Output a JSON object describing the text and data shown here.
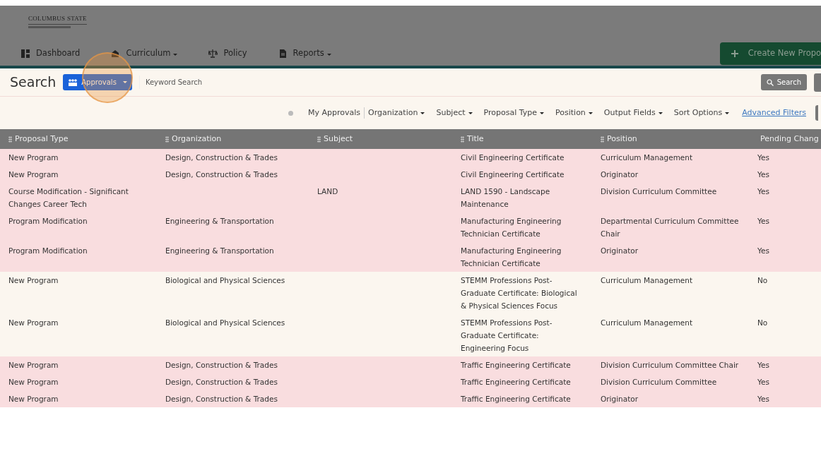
{
  "logo": {
    "text": "COLUMBUS STATE"
  },
  "nav": [
    {
      "label": "Dashboard",
      "kind": "link"
    },
    {
      "label": "Curriculum",
      "kind": "dropdown"
    },
    {
      "label": "Policy",
      "kind": "link"
    },
    {
      "label": "Reports",
      "kind": "dropdown"
    }
  ],
  "create_button": {
    "label": "Create New Propo"
  },
  "search_bar": {
    "title": "Search",
    "mode_button": "Approvals",
    "keyword": {
      "placeholder": "Keyword Search"
    },
    "search_button": "Search"
  },
  "filters": [
    {
      "kind": "plain",
      "label": "My Approvals"
    },
    {
      "kind": "dropdown",
      "label": "Organization"
    },
    {
      "kind": "dropdown",
      "label": "Subject"
    },
    {
      "kind": "dropdown",
      "label": "Proposal Type"
    },
    {
      "kind": "dropdown",
      "label": "Position"
    },
    {
      "kind": "dropdown",
      "label": "Output Fields"
    },
    {
      "kind": "dropdown",
      "label": "Sort Options"
    },
    {
      "kind": "link",
      "label": "Advanced Filters"
    }
  ],
  "table": {
    "columns": [
      "Proposal Type",
      "Organization",
      "Subject",
      "Title",
      "Position",
      "Pending Chang"
    ],
    "rows": [
      {
        "highlighted": true,
        "cells": [
          "New Program",
          "Design, Construction & Trades",
          "",
          "Civil Engineering Certificate",
          "Curriculum Management",
          "Yes"
        ]
      },
      {
        "highlighted": true,
        "cells": [
          "New Program",
          "Design, Construction & Trades",
          "",
          "Civil Engineering Certificate",
          "Originator",
          "Yes"
        ]
      },
      {
        "highlighted": true,
        "cells": [
          "Course Modification - Significant Changes Career Tech",
          "",
          "LAND",
          "LAND 1590 - Landscape Maintenance",
          "Division Curriculum Committee",
          "Yes"
        ]
      },
      {
        "highlighted": true,
        "cells": [
          "Program Modification",
          "Engineering & Transportation",
          "",
          "Manufacturing Engineering Technician Certificate",
          "Departmental Curriculum Committee Chair",
          "Yes"
        ]
      },
      {
        "highlighted": true,
        "cells": [
          "Program Modification",
          "Engineering & Transportation",
          "",
          "Manufacturing Engineering Technician Certificate",
          "Originator",
          "Yes"
        ]
      },
      {
        "highlighted": false,
        "cells": [
          "New Program",
          "Biological and Physical Sciences",
          "",
          "STEMM Professions Post-Graduate Certificate: Biological & Physical Sciences Focus",
          "Curriculum Management",
          "No"
        ]
      },
      {
        "highlighted": false,
        "cells": [
          "New Program",
          "Biological and Physical Sciences",
          "",
          "STEMM Professions Post-Graduate Certificate: Engineering Focus",
          "Curriculum Management",
          "No"
        ]
      },
      {
        "highlighted": true,
        "cells": [
          "New Program",
          "Design, Construction & Trades",
          "",
          "Traffic Engineering Certificate",
          "Division Curriculum Committee Chair",
          "Yes"
        ]
      },
      {
        "highlighted": true,
        "cells": [
          "New Program",
          "Design, Construction & Trades",
          "",
          "Traffic Engineering Certificate",
          "Division Curriculum Committee",
          "Yes"
        ]
      },
      {
        "highlighted": true,
        "cells": [
          "New Program",
          "Design, Construction & Trades",
          "",
          "Traffic Engineering Certificate",
          "Originator",
          "Yes"
        ]
      }
    ]
  }
}
